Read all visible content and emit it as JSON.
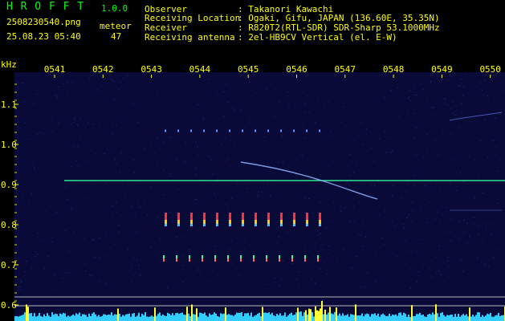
{
  "app": {
    "name": "H R O F F T",
    "version": "1.0.0",
    "filename": "2508230540.png",
    "datetime": "25.08.23 05:40",
    "meteor_label": "meteor",
    "meteor_count": "47",
    "name_color": "#00ff00",
    "accent_color": "#ffff00"
  },
  "info": {
    "rows": [
      {
        "label": "Observer",
        "value": ": Takanori Kawachi"
      },
      {
        "label": "Receiving Location",
        "value": ": Ogaki, Gifu, JAPAN (136.60E, 35.35N)"
      },
      {
        "label": "Receiver",
        "value": ": R820T2(RTL-SDR) SDR-Sharp 53.1000MHz"
      },
      {
        "label": "Receiving antenna",
        "value": ": 2el-HB9CV Vertical (el. E-W)"
      }
    ]
  },
  "spectrogram": {
    "y_unit": "kHz",
    "time_ticks": [
      "0541",
      "0542",
      "0543",
      "0544",
      "0545",
      "0546",
      "0547",
      "0548",
      "0549",
      "0550"
    ],
    "freq_ticks": [
      "1.1",
      "1.0",
      "0.9",
      "0.8",
      "0.7",
      "0.6"
    ],
    "background_color": "#0a0a38",
    "label_color": "#ffff00",
    "carrier_color": "#33ff99",
    "activity_color": "#33ccff"
  }
}
